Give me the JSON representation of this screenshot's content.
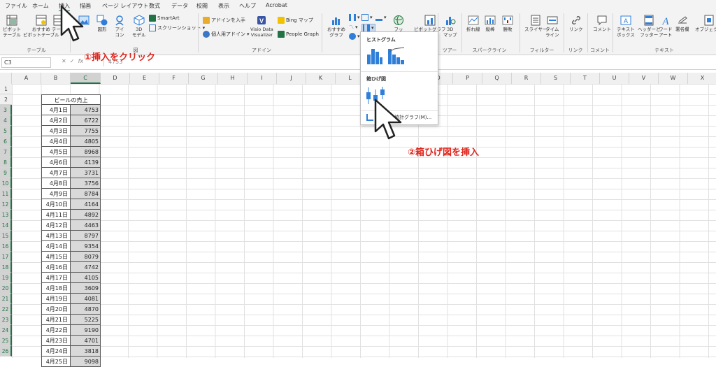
{
  "tabs": [
    "ファイル",
    "ホーム",
    "挿入",
    "描画",
    "ページ レイアウト",
    "数式",
    "データ",
    "校閲",
    "表示",
    "ヘルプ",
    "Acrobat"
  ],
  "ribbon": {
    "table_group": {
      "label": "テーブル",
      "buttons": [
        "ピボット\nテーブル",
        "おすすめ\nピボットテーブル",
        "テーブ"
      ]
    },
    "illust_group": {
      "label": "図",
      "buttons": [
        "図形",
        "アイ\nコン",
        "3D\nモデル"
      ],
      "small": [
        "SmartArt",
        "スクリーンショット"
      ]
    },
    "addin_group": {
      "label": "アドイン",
      "small": [
        "アドインを入手",
        "個人用アドイン"
      ],
      "visio": "Visio Data\nVisualizer",
      "bing": "Bing マップ",
      "people": "People Graph"
    },
    "chart_group": {
      "rec": "おすすめ\nグラフ",
      "map": "3D\nマップ",
      "tour_label": "ツアー",
      "partial": [
        "フッ",
        "ピボットグラフ"
      ]
    },
    "sparkline_group": {
      "label": "スパークライン",
      "buttons": [
        "折れ線",
        "縦棒",
        "勝敗"
      ]
    },
    "filter_group": {
      "label": "フィルター",
      "buttons": [
        "スライサー",
        "タイム\nライン"
      ]
    },
    "link_group": {
      "label": "リンク",
      "buttons": [
        "リンク"
      ]
    },
    "comment_group": {
      "label": "コメント",
      "buttons": [
        "コメント"
      ]
    },
    "text_group": {
      "label": "テキスト",
      "buttons": [
        "テキスト\nボックス",
        "ヘッダーと\nフッター",
        "ワード\nアート",
        "署名欄",
        "オブジェクト"
      ]
    }
  },
  "formula_bar": {
    "name_box": "C3",
    "formula": "4753"
  },
  "columns": [
    "A",
    "B",
    "C",
    "D",
    "E",
    "F",
    "G",
    "H",
    "I",
    "J",
    "K",
    "L",
    "M",
    "N",
    "O",
    "P",
    "Q",
    "R",
    "S",
    "T",
    "U",
    "V",
    "W",
    "X"
  ],
  "table": {
    "title": "ビールの売上",
    "rows": [
      [
        "4月1日",
        "4753"
      ],
      [
        "4月2日",
        "6722"
      ],
      [
        "4月3日",
        "7755"
      ],
      [
        "4月4日",
        "4805"
      ],
      [
        "4月5日",
        "8968"
      ],
      [
        "4月6日",
        "4139"
      ],
      [
        "4月7日",
        "3731"
      ],
      [
        "4月8日",
        "3756"
      ],
      [
        "4月9日",
        "8784"
      ],
      [
        "4月10日",
        "4164"
      ],
      [
        "4月11日",
        "4892"
      ],
      [
        "4月12日",
        "4463"
      ],
      [
        "4月13日",
        "8797"
      ],
      [
        "4月14日",
        "9354"
      ],
      [
        "4月15日",
        "8079"
      ],
      [
        "4月16日",
        "4742"
      ],
      [
        "4月17日",
        "4105"
      ],
      [
        "4月18日",
        "3609"
      ],
      [
        "4月19日",
        "4081"
      ],
      [
        "4月20日",
        "4870"
      ],
      [
        "4月21日",
        "5225"
      ],
      [
        "4月22日",
        "9190"
      ],
      [
        "4月23日",
        "4701"
      ],
      [
        "4月24日",
        "3818"
      ],
      [
        "4月25日",
        "9098"
      ]
    ]
  },
  "dropdown": {
    "histogram": "ヒストグラム",
    "boxplot": "箱ひげ図",
    "more": "その他の統計グラフ(M)..."
  },
  "annotations": {
    "step1": "①挿入をクリック",
    "step2": "②箱ひげ図を挿入"
  },
  "colors": {
    "excel_green": "#217346",
    "annotation_red": "#e0241b",
    "chart_blue": "#2f7ed8"
  }
}
